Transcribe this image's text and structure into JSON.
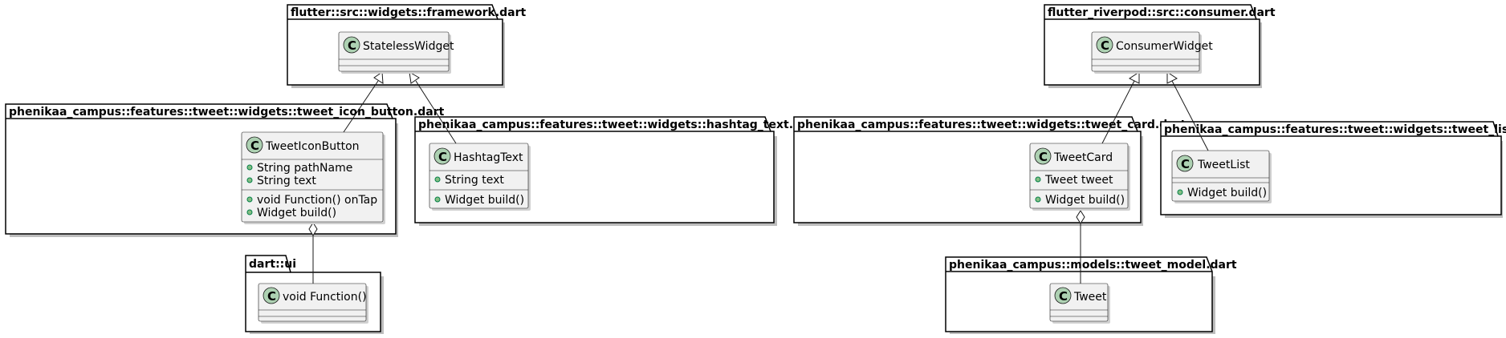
{
  "packages": {
    "framework": {
      "title": "flutter::src::widgets::framework.dart"
    },
    "consumer": {
      "title": "flutter_riverpod::src::consumer.dart"
    },
    "tweet_icon_button": {
      "title": "phenikaa_campus::features::tweet::widgets::tweet_icon_button.dart"
    },
    "hashtag_text": {
      "title": "phenikaa_campus::features::tweet::widgets::hashtag_text.dart"
    },
    "tweet_card": {
      "title": "phenikaa_campus::features::tweet::widgets::tweet_card.dart"
    },
    "tweet_list": {
      "title": "phenikaa_campus::features::tweet::widgets::tweet_list.dart"
    },
    "dart_ui": {
      "title": "dart::ui"
    },
    "tweet_model": {
      "title": "phenikaa_campus::models::tweet_model.dart"
    }
  },
  "classes": {
    "stateless_widget": {
      "name": "StatelessWidget",
      "badge": "C"
    },
    "consumer_widget": {
      "name": "ConsumerWidget",
      "badge": "C"
    },
    "tweet_icon_button": {
      "name": "TweetIconButton",
      "badge": "C",
      "fields": [
        "String pathName",
        "String text"
      ],
      "methods": [
        "void Function() onTap",
        "Widget build()"
      ]
    },
    "hashtag_text": {
      "name": "HashtagText",
      "badge": "C",
      "fields": [
        "String text"
      ],
      "methods": [
        "Widget build()"
      ]
    },
    "tweet_card": {
      "name": "TweetCard",
      "badge": "C",
      "fields": [
        "Tweet tweet"
      ],
      "methods": [
        "Widget build()"
      ]
    },
    "tweet_list": {
      "name": "TweetList",
      "badge": "C",
      "methods": [
        "Widget build()"
      ]
    },
    "void_function": {
      "name": "void Function()",
      "badge": "C"
    },
    "tweet": {
      "name": "Tweet",
      "badge": "C"
    }
  },
  "relations": [
    {
      "from": "tweet_icon_button",
      "to": "stateless_widget",
      "kind": "inheritance"
    },
    {
      "from": "hashtag_text",
      "to": "stateless_widget",
      "kind": "inheritance"
    },
    {
      "from": "tweet_card",
      "to": "consumer_widget",
      "kind": "inheritance"
    },
    {
      "from": "tweet_list",
      "to": "consumer_widget",
      "kind": "inheritance"
    },
    {
      "from": "tweet_icon_button",
      "to": "void_function",
      "kind": "aggregation"
    },
    {
      "from": "tweet_card",
      "to": "tweet",
      "kind": "aggregation"
    }
  ],
  "colors": {
    "class_fill": "#f1f1f1",
    "badge_fill": "#add1b2",
    "visibility_fill": "#84be84",
    "package_border": "#000000"
  }
}
